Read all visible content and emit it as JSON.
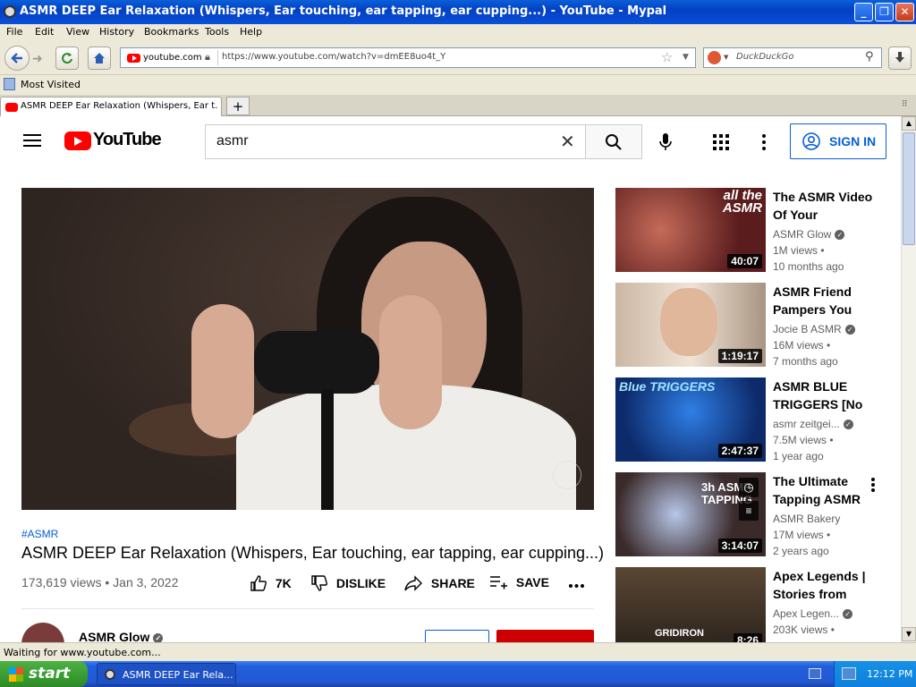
{
  "window": {
    "title": "ASMR DEEP Ear Relaxation (Whispers, Ear touching, ear tapping, ear cupping...) - YouTube - Mypal"
  },
  "menu": [
    "File",
    "Edit",
    "View",
    "History",
    "Bookmarks",
    "Tools",
    "Help"
  ],
  "nav": {
    "site_identity": "youtube.com",
    "url": "https://www.youtube.com/watch?v=dmEE8uo4t_Y",
    "search_placeholder": "DuckDuckGo"
  },
  "bookmarks": {
    "most_visited": "Most Visited"
  },
  "tabs": [
    {
      "label": "ASMR DEEP Ear Relaxation (Whispers, Ear t..."
    }
  ],
  "youtube": {
    "logo_text": "YouTube",
    "search_query": "asmr",
    "signin_label": "SIGN IN",
    "video": {
      "hashtag": "#ASMR",
      "title": "ASMR DEEP Ear Relaxation (Whispers, Ear touching, ear tapping, ear cupping...)",
      "meta": "173,619 views • Jan 3, 2022",
      "likes": "7K",
      "dislike_label": "DISLIKE",
      "share_label": "SHARE",
      "save_label": "SAVE"
    },
    "channel": {
      "name": "ASMR Glow"
    },
    "recommendations": [
      {
        "title": "The ASMR Video Of Your",
        "channel": "ASMR Glow",
        "views": "1M views •",
        "age": "10 months ago",
        "duration": "40:07",
        "thumb_color": "#5a1c1c",
        "thumb_text": "all the ASMR"
      },
      {
        "title": "ASMR Friend Pampers You",
        "channel": "Jocie B ASMR",
        "views": "16M views •",
        "age": "7 months ago",
        "duration": "1:19:17",
        "thumb_color": "#b49a84",
        "thumb_text": ""
      },
      {
        "title": "ASMR BLUE TRIGGERS [No",
        "channel": "asmr zeitgei...",
        "views": "7.5M views •",
        "age": "1 year ago",
        "duration": "2:47:37",
        "thumb_color": "#0d2a6a",
        "thumb_text": "Blue TRIGGERS"
      },
      {
        "title": "The Ultimate Tapping ASMR",
        "channel": "ASMR Bakery",
        "views": "17M views •",
        "age": "2 years ago",
        "duration": "3:14:07",
        "thumb_color": "#3a2a2a",
        "thumb_text": "3h ASMR TAPPING"
      },
      {
        "title": "Apex Legends | Stories from",
        "channel": "Apex Legen...",
        "views": "203K views •",
        "age": "",
        "duration": "8:26",
        "thumb_color": "#3a3026",
        "thumb_text": "GRIDIRON"
      }
    ]
  },
  "status": {
    "text": "Waiting for www.youtube.com..."
  },
  "taskbar": {
    "start_label": "start",
    "task_label": "ASMR DEEP Ear Rela...",
    "clock": "12:12 PM"
  }
}
